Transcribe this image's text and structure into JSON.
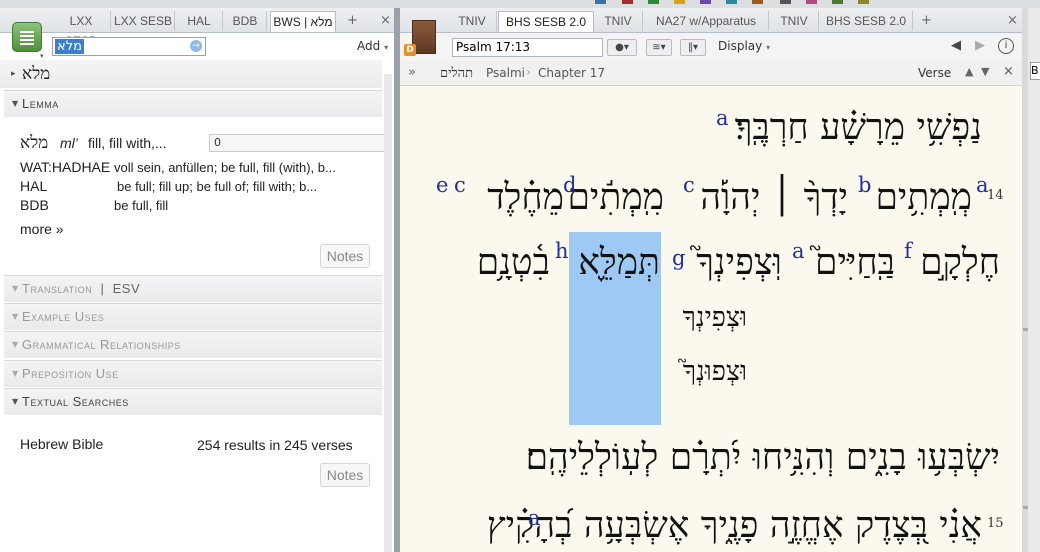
{
  "colors": {
    "accent": "#3d7fcf",
    "link": "#2f6ea8",
    "footnote": "#1f2f9c",
    "highlight": "#9ec9f4",
    "paper": "#fbf8ed",
    "badge": "#e5902a"
  },
  "left": {
    "tabs": [
      "LXX SESB",
      "LXX SESB",
      "HAL",
      "BDB",
      "BWS | מלא"
    ],
    "add_tab": "+",
    "close": "×",
    "search_value": "מלא",
    "add_label": "Add",
    "header_word": "מלא",
    "sections": {
      "lemma": "Lemma",
      "translation": "Translation",
      "translation_version": "ESV",
      "example_uses": "Example Uses",
      "grammatical": "Grammatical Relationships",
      "preposition": "Preposition Use",
      "textual": "Textual Searches"
    },
    "lemma": {
      "hebrew": "מלא",
      "translit": "ml’",
      "gloss": "fill, fill with,...",
      "count": "0",
      "entries": [
        {
          "source": "WAT:HADHAE",
          "def": "voll sein, anfüllen; be full, fill (with), b..."
        },
        {
          "source": "HAL",
          "def": "be full;  fill up;  be full of;  fill with;  b..."
        },
        {
          "source": "BDB",
          "def": "be full, fill"
        }
      ],
      "more": "more »"
    },
    "notes": "Notes",
    "search_result": {
      "label": "Hebrew Bible",
      "count": "254 results in 245 verses"
    }
  },
  "right": {
    "tabs": [
      "TNIV",
      "BHS SESB 2.0",
      "TNIV",
      "NA27 w/Apparatus",
      "TNIV",
      "BHS SESB 2.0"
    ],
    "add_tab": "+",
    "close": "×",
    "reference": "Psalm 17:13",
    "display_label": "Display",
    "breadcrumb": {
      "expand": "»",
      "book_heb": "תהלים",
      "book": "Psalmi",
      "chapter": "Chapter 17"
    },
    "verse_label": "Verse",
    "lines": {
      "l1": "נַפְשִׁ֥י מֵרָשָׁ֗ע חַרְבֶּֽךָ׃",
      "l2a": "מְֽמְתִ֥ים",
      "l2b": "יָדְךָ֨ ׀ יְהוָ֡ה",
      "l2c": "מִֽמְתִ֬ים",
      "l2d": "מֵחֶ֗לֶד",
      "l3a": "חֶלְקָ֣ם",
      "l3b": "בַּֽחַיִּים֮",
      "l3c": "וּֽצְפִינְךָ֮",
      "l3d": "תְּמַלֵּ֪א",
      "l3e": "בִ֫טְנָ֥ם",
      "l4": "וּצְפִינְךָ",
      "l5": "וּצְפוּנְךָ֮",
      "l6": "יִשְׂבְּע֥וּ בָנִ֑ים וְהִנִּ֥יחוּ יִ֝תְרָ֗ם לְעֽוֹלְלֵיהֶֽם׃",
      "l7": "אֲנִ֗י בְּ֭צֶדֶק אֶחֱזֶ֣ה פָנֶ֑יךָ אֶשְׂבְּעָ֥ה בְ֝הָקִ֗יץ"
    },
    "footnotes": {
      "a1": "a",
      "a2": "a",
      "b": "b",
      "c": "c",
      "d": "d",
      "e": "e",
      "c2": "c",
      "f": "f",
      "a3": "a",
      "g": "g",
      "h": "h",
      "a4": "a"
    },
    "verse_numbers": {
      "v14": "14",
      "v15": "15"
    }
  }
}
